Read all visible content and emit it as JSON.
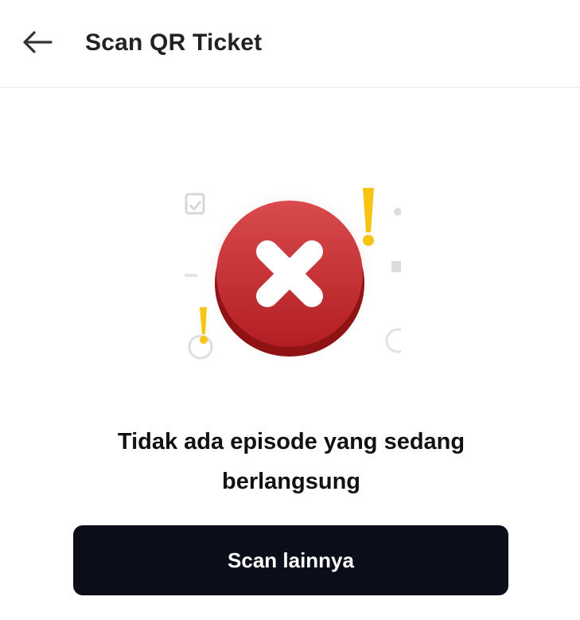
{
  "header": {
    "back_icon": "arrow-left-icon",
    "title": "Scan QR Ticket"
  },
  "status": {
    "illustration_icon": "error-x-icon",
    "message_line1": "Tidak ada episode yang sedang",
    "message_line2": "berlangsung"
  },
  "actions": {
    "scan_again_label": "Scan lainnya"
  },
  "colors": {
    "error_red": "#c8282c",
    "warning_yellow": "#f7c414",
    "button_bg": "#0b0e18"
  }
}
